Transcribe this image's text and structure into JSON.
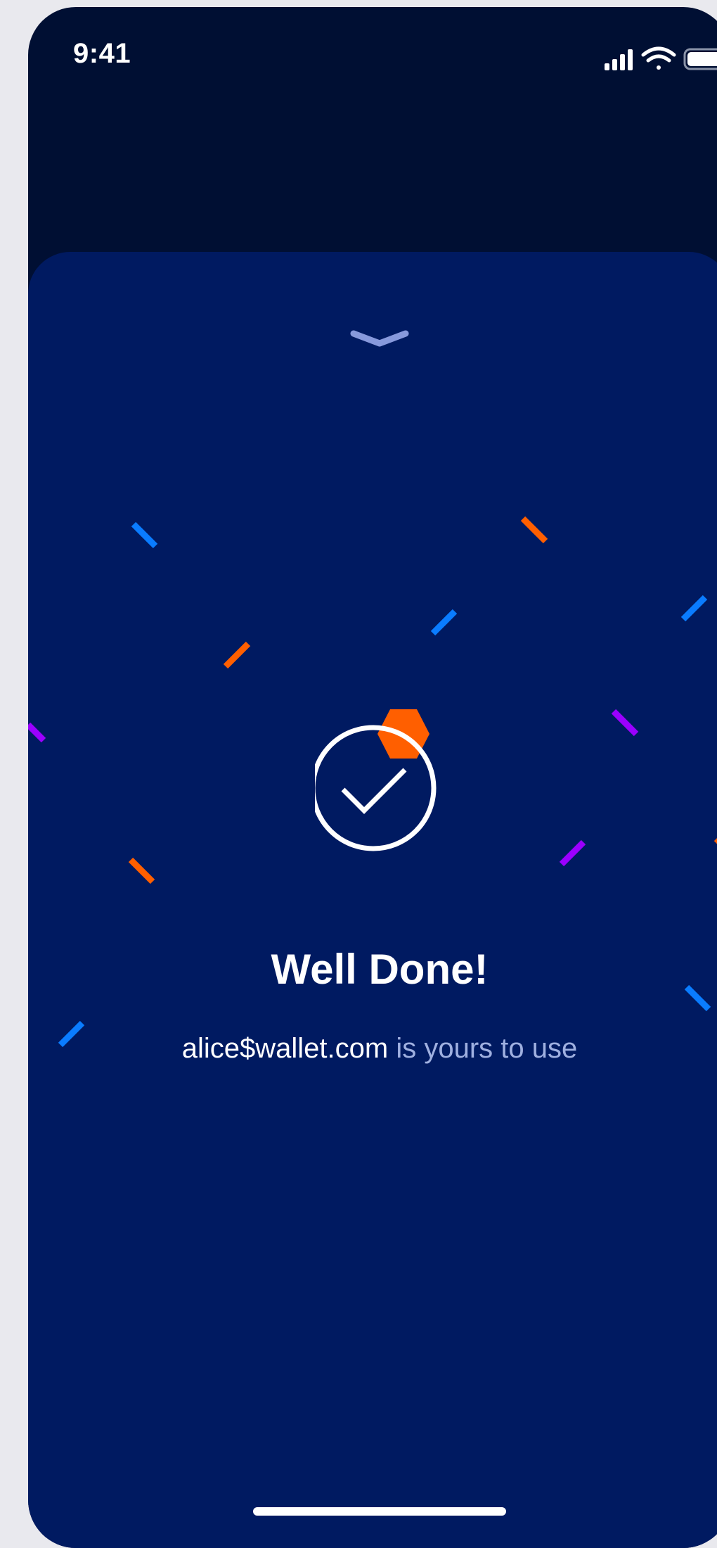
{
  "status_bar": {
    "time": "9:41",
    "icons": [
      "cellular-signal-icon",
      "wifi-icon",
      "battery-icon"
    ]
  },
  "sheet": {
    "handle_icon": "chevron-down-icon",
    "success_icon": "check-circle-icon",
    "title": "Well Done!",
    "address": "alice$wallet.com",
    "message": " is yours to use"
  },
  "colors": {
    "background": "#000f33",
    "sheet": "#001a61",
    "accent_orange": "#ff5f00",
    "accent_blue": "#0a7cff",
    "accent_purple": "#9b00ff",
    "muted_text": "#9fb0e0"
  }
}
